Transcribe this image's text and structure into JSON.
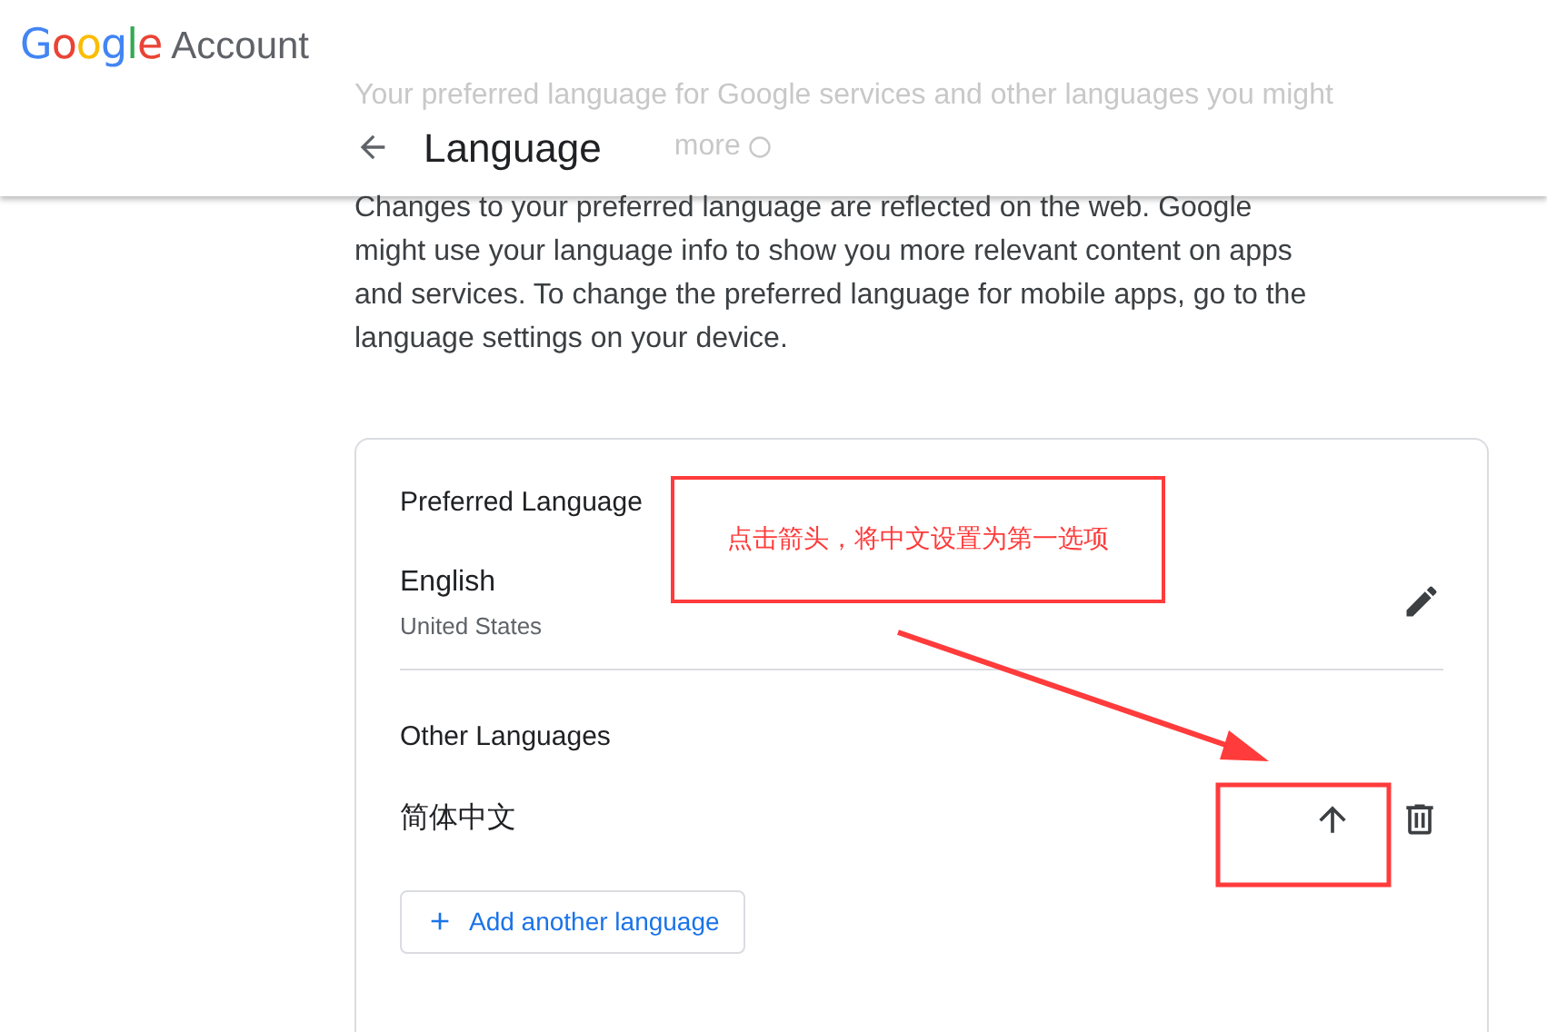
{
  "header": {
    "logo": "Google",
    "product": "Account"
  },
  "intro": {
    "line_1": "Your preferred language for Google services and other languages you might",
    "line_2": "more"
  },
  "page_title": "Language",
  "description": "Changes to your preferred language are reflected on the web. Google might use your language info to show you more relevant content on apps and services. To change the preferred language for mobile apps, go to the language settings on your device.",
  "preferred": {
    "heading": "Preferred Language",
    "language": "English",
    "region": "United States"
  },
  "other": {
    "heading": "Other Languages",
    "languages": [
      {
        "name": "简体中文"
      }
    ]
  },
  "add_button": "Add another language",
  "annotation": {
    "note": "点击箭头，将中文设置为第一选项"
  }
}
